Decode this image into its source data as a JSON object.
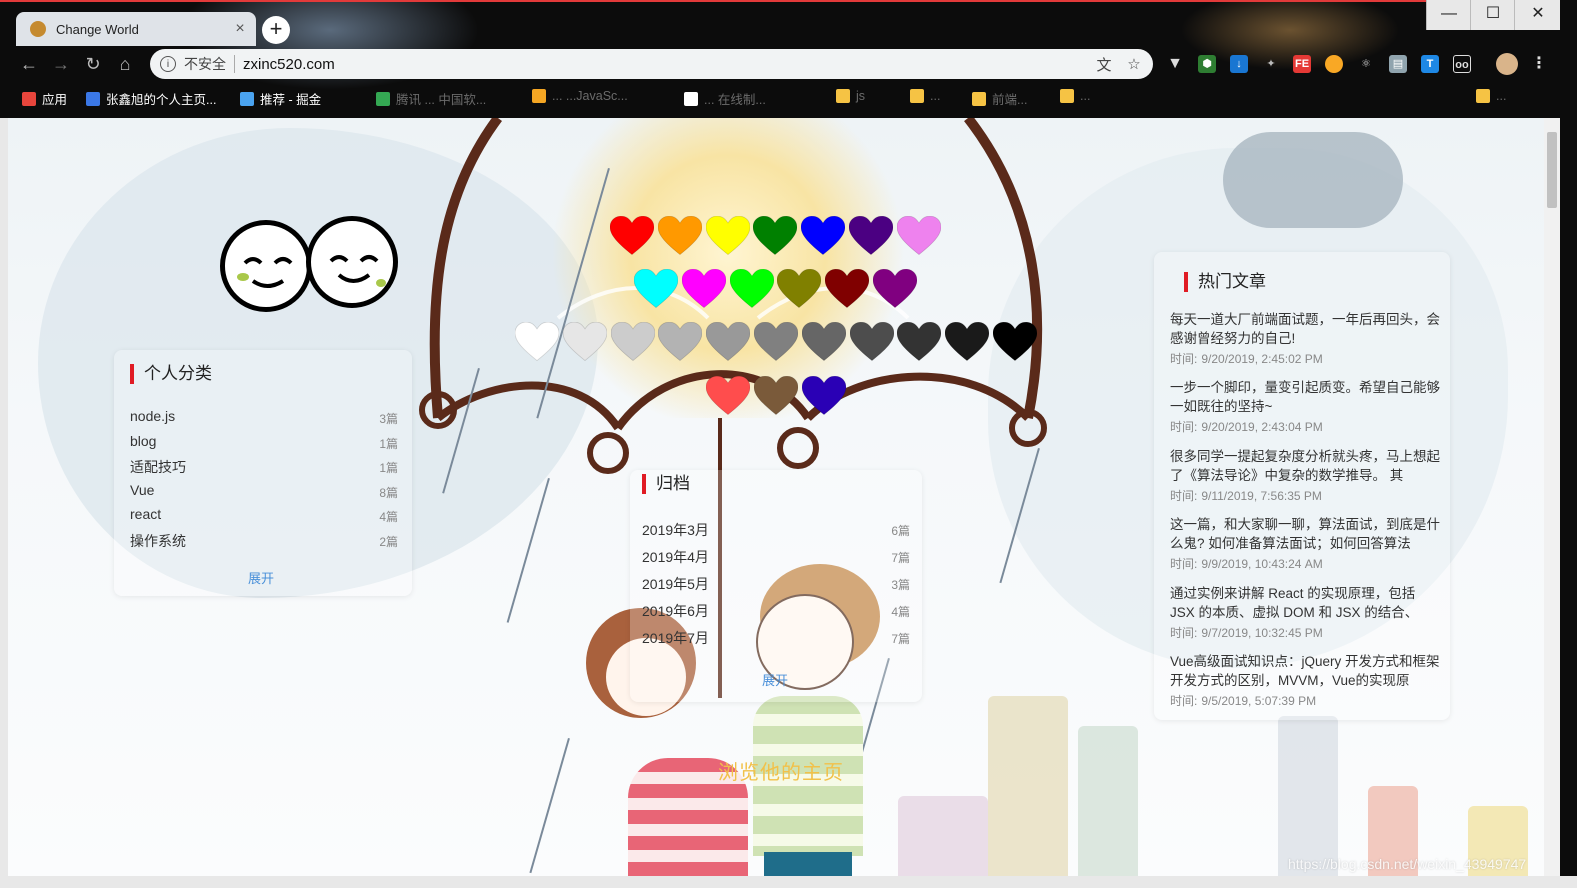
{
  "browser": {
    "tab_title": "Change World",
    "tab_close": "×",
    "new_tab": "+",
    "window_controls": {
      "minimize": "—",
      "maximize": "☐",
      "close": "✕"
    },
    "insecure_label": "不安全",
    "url": "zxinc520.com",
    "bookmarks": [
      {
        "label": "应用",
        "icon_color": "#e8453c",
        "dim": false
      },
      {
        "label": "张鑫旭的个人主页...",
        "icon_color": "#3b78e7",
        "dim": false
      },
      {
        "label": "推荐 - 掘金",
        "icon_color": "#4aa3f0",
        "dim": false
      },
      {
        "label": "腾讯 ... 中国软...",
        "icon_color": "#34a853",
        "dim": true
      },
      {
        "label": "... ...JavaSc...",
        "icon_color": "#f5a623",
        "dim": true
      },
      {
        "label": "... 在线制...",
        "icon_color": "#ffffff",
        "dim": true
      },
      {
        "label": "js",
        "icon_color": "#f6c344",
        "dim": true
      },
      {
        "label": "...",
        "icon_color": "#f6c344",
        "dim": true
      },
      {
        "label": "前端...",
        "icon_color": "#f6c344",
        "dim": true
      },
      {
        "label": "...",
        "icon_color": "#f6c344",
        "dim": true
      },
      {
        "label": "...",
        "icon_color": "#f6c344",
        "dim": true
      }
    ]
  },
  "categories": {
    "title": "个人分类",
    "items": [
      {
        "name": "node.js",
        "count": "3篇"
      },
      {
        "name": "blog",
        "count": "1篇"
      },
      {
        "name": "适配技巧",
        "count": "1篇"
      },
      {
        "name": "Vue",
        "count": "8篇"
      },
      {
        "name": "react",
        "count": "4篇"
      },
      {
        "name": "操作系统",
        "count": "2篇"
      }
    ],
    "expand": "展开"
  },
  "archive": {
    "title": "归档",
    "items": [
      {
        "month": "2019年3月",
        "count": "6篇"
      },
      {
        "month": "2019年4月",
        "count": "7篇"
      },
      {
        "month": "2019年5月",
        "count": "3篇"
      },
      {
        "month": "2019年6月",
        "count": "4篇"
      },
      {
        "month": "2019年7月",
        "count": "7篇"
      }
    ],
    "expand": "展开"
  },
  "hot_posts": {
    "title": "热门文章",
    "time_prefix": "时间:",
    "items": [
      {
        "title": "每天一道大厂前端面试题，一年后再回头，会感谢曾经努力的自己!",
        "time": "9/20/2019, 2:45:02 PM"
      },
      {
        "title": "一步一个脚印，量变引起质变。希望自己能够一如既往的坚持~",
        "time": "9/20/2019, 2:43:04 PM"
      },
      {
        "title": "很多同学一提起复杂度分析就头疼，马上想起了《算法导论》中复杂的数学推导。 其",
        "time": "9/11/2019, 7:56:35 PM"
      },
      {
        "title": "这一篇，和大家聊一聊，算法面试，到底是什么鬼? 如何准备算法面试；如何回答算法",
        "time": "9/9/2019, 10:43:24 AM"
      },
      {
        "title": "通过实例来讲解 React 的实现原理，包括 JSX 的本质、虚拟 DOM 和 JSX 的结合、",
        "time": "9/7/2019, 10:32:45 PM"
      },
      {
        "title": "Vue高级面试知识点：jQuery 开发方式和框架开发方式的区别，MVVM，Vue的实现原",
        "time": "9/5/2019, 5:07:39 PM"
      }
    ]
  },
  "hearts": {
    "row1": [
      "#ff0000",
      "#ff9900",
      "#ffff00",
      "#008000",
      "#0000ff",
      "#4b0082",
      "#ee82ee"
    ],
    "row2": [
      "#00ffff",
      "#ff00ff",
      "#00ff00",
      "#808000",
      "#800000",
      "#800080"
    ],
    "row3": [
      "#ffffff",
      "#e6e6e6",
      "#cccccc",
      "#b3b3b3",
      "#999999",
      "#808080",
      "#666666",
      "#4d4d4d",
      "#333333",
      "#1a1a1a",
      "#000000"
    ],
    "row4": [
      "#ff4d4d",
      "#7a5a3a",
      "#2a00b5"
    ]
  },
  "footer": {
    "welcome": "浏览他的主页",
    "watermark": "https://blog.csdn.net/weixin_43949747"
  }
}
